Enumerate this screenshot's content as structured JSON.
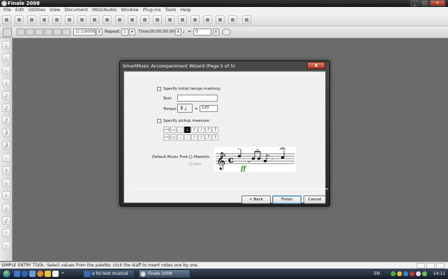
{
  "window": {
    "title": "Finale 2008"
  },
  "window_controls": {
    "minimize": "_",
    "maximize": "□",
    "close": "×"
  },
  "menu": [
    "File",
    "Edit",
    "Utilities",
    "View",
    "Document",
    "MIDI/Audio",
    "Window",
    "Plug-ins",
    "Tools",
    "Help"
  ],
  "playback": {
    "measure_label": "1| 1|0000",
    "repeat_label": "Repeat:",
    "repeat_value": "1",
    "time_label": "Time:",
    "time_value": "00:00:00.000",
    "tempo_eq": "=",
    "tempo_value": "0"
  },
  "palette_glyphs": [
    "𝅘𝅥",
    "𝅘𝅥",
    "𝅗𝅥",
    "𝅘𝅥",
    "𝅘𝅥𝅮",
    "𝅘𝅥𝅯",
    "𝅘𝅥𝅰",
    "𝅘𝅥𝅱",
    "𝅘𝅥𝅲",
    "·",
    "♯",
    "♭",
    "♮",
    "♩",
    "♪",
    "𝄻",
    "𝄾"
  ],
  "status": {
    "text": "SIMPLE ENTRY TOOL: Select values from the palette; click the staff to insert notes one by one."
  },
  "taskbar": {
    "language": "EN",
    "clock": "14:11",
    "tasks": [
      {
        "label": "a foi test muzical"
      },
      {
        "label": "Finale 2008"
      }
    ]
  },
  "dialog": {
    "title": "SmartMusic Accompaniment Wizard (Page 5 of 5)",
    "close_glyph": "x",
    "tempo_marking": {
      "checkbox_label": "Specify initial tempo marking:",
      "text_label": "Text:",
      "text_value": "",
      "tempo_label": "Tempo:",
      "tempo_equals": "=",
      "tempo_value": "120"
    },
    "pickup": {
      "checkbox_label": "Specify pickup measure:",
      "row1_label": "(dot)",
      "row2_label": "(tie)",
      "row1": [
        "▭",
        "𝅗𝅥",
        "♩",
        "♪",
        "𝅘𝅥𝅯",
        "𝅘𝅥𝅰",
        "𝅘𝅥𝅱"
      ],
      "row2": [
        "▭",
        "𝅗𝅥",
        "♩",
        "♪",
        "𝅘𝅥𝅯",
        "𝅘𝅥𝅰",
        "𝅘𝅥𝅱"
      ],
      "selected_index": 2
    },
    "font": {
      "label": "Default Music Font:",
      "option1": "Maestro",
      "option2": "Jazz",
      "selected": "Maestro",
      "preview_dynamic": "ff",
      "preview_time_sig": "c"
    },
    "buttons": {
      "back": "< Back",
      "finish": "Finish",
      "cancel": "Cancel"
    }
  },
  "colors": {
    "workspace": "#6b6b6b",
    "dialog_frame": "#262626",
    "dynamic_green": "#2e8b24",
    "taskbar": "#1b2636"
  }
}
